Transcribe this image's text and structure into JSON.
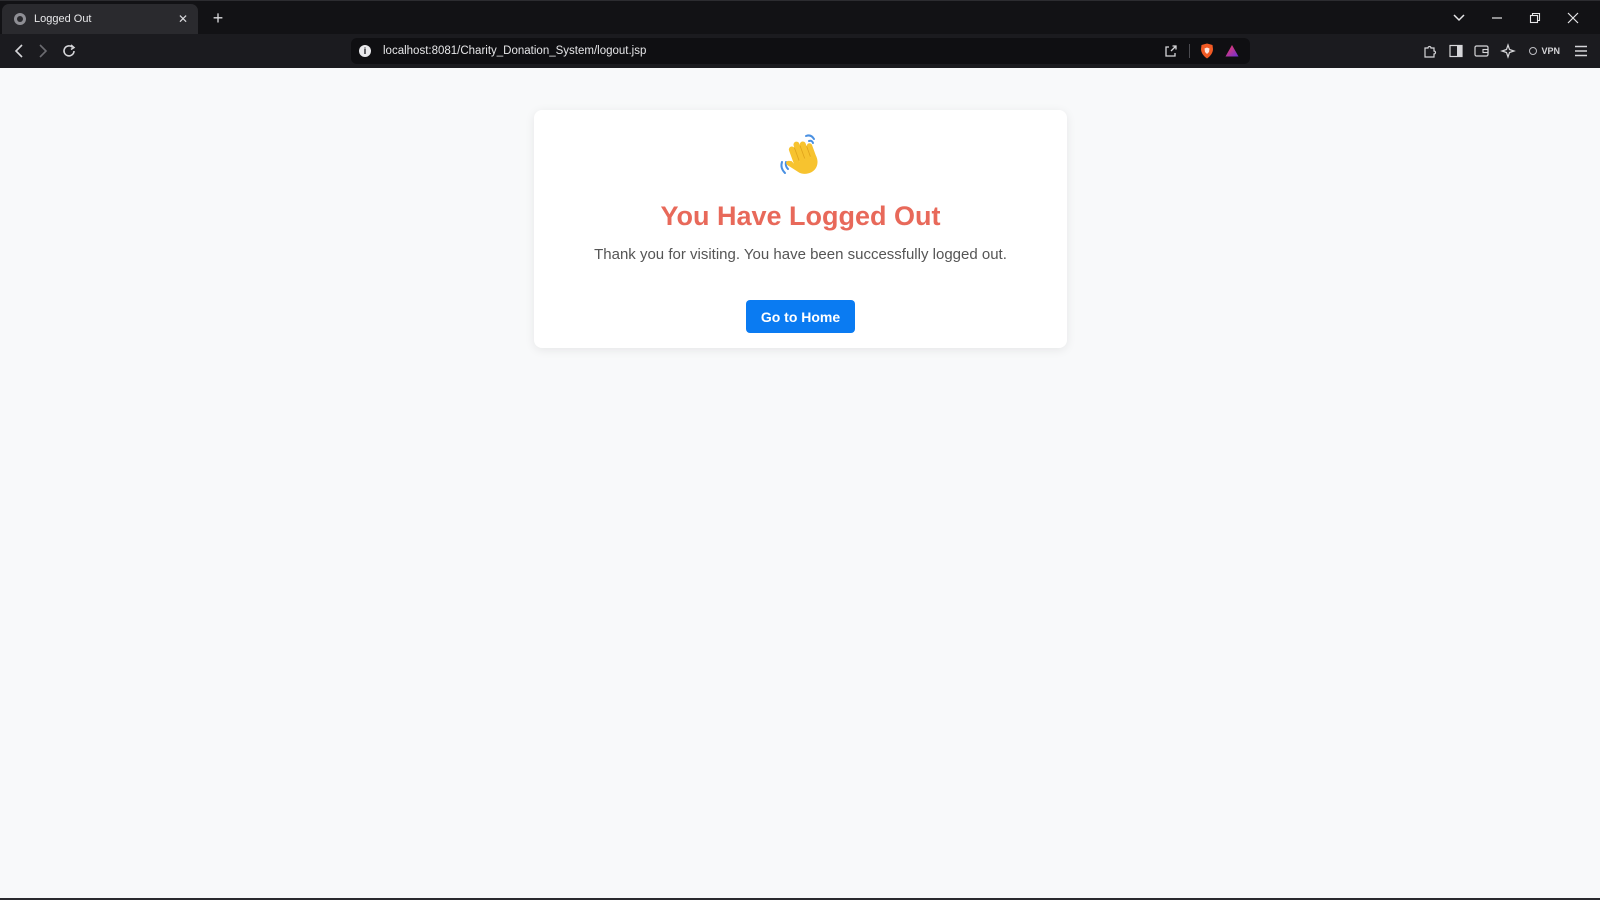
{
  "browser": {
    "tab": {
      "title": "Logged Out",
      "close": "✕"
    },
    "new_tab": "+",
    "window": {
      "minimize": "─",
      "restore": "❐",
      "close": "✕",
      "tab_search": "⌄"
    },
    "nav": {
      "back": "‹",
      "forward": "›",
      "reload": "↻"
    },
    "address": {
      "url": "localhost:8081/Charity_Donation_System/logout.jsp",
      "info": "i"
    },
    "vpn_label": "VPN",
    "icons": {
      "site_info": "info-icon",
      "share": "share-icon",
      "shields": "brave-shields-icon",
      "rewards": "brave-rewards-icon",
      "extensions": "puzzle-icon",
      "sidebar": "sidebar-icon",
      "wallet": "wallet-icon",
      "leo": "leo-ai-icon",
      "menu": "hamburger-menu-icon"
    }
  },
  "page": {
    "emoji": "👋",
    "heading": "You Have Logged Out",
    "message": "Thank you for visiting. You have been successfully logged out.",
    "home_button": "Go to Home"
  },
  "colors": {
    "heading": "#e8695a",
    "button": "#0a7bf2",
    "page_bg": "#f8f9fa",
    "card_bg": "#ffffff",
    "chrome_bg": "#1b1b1f"
  }
}
